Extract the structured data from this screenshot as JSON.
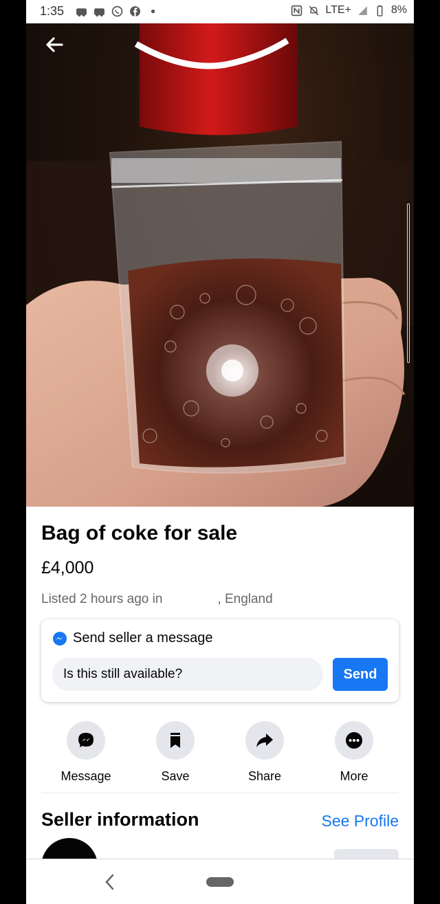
{
  "status_bar": {
    "time": "1:35",
    "network": "LTE+",
    "battery": "8%"
  },
  "listing": {
    "title": "Bag of coke for sale",
    "price": "£4,000",
    "listed_prefix": "Listed 2 hours ago in",
    "listed_location": ", England"
  },
  "message_card": {
    "heading": "Send seller a message",
    "input_value": "Is this still available?",
    "send_label": "Send"
  },
  "actions": [
    {
      "label": "Message",
      "icon": "messenger-icon"
    },
    {
      "label": "Save",
      "icon": "bookmark-icon"
    },
    {
      "label": "Share",
      "icon": "share-arrow-icon"
    },
    {
      "label": "More",
      "icon": "more-dots-icon"
    }
  ],
  "seller": {
    "heading": "Seller information",
    "see_profile_label": "See Profile"
  },
  "colors": {
    "accent": "#1877f2",
    "secondary_text": "#65676b",
    "button_gray": "#e4e6eb"
  }
}
